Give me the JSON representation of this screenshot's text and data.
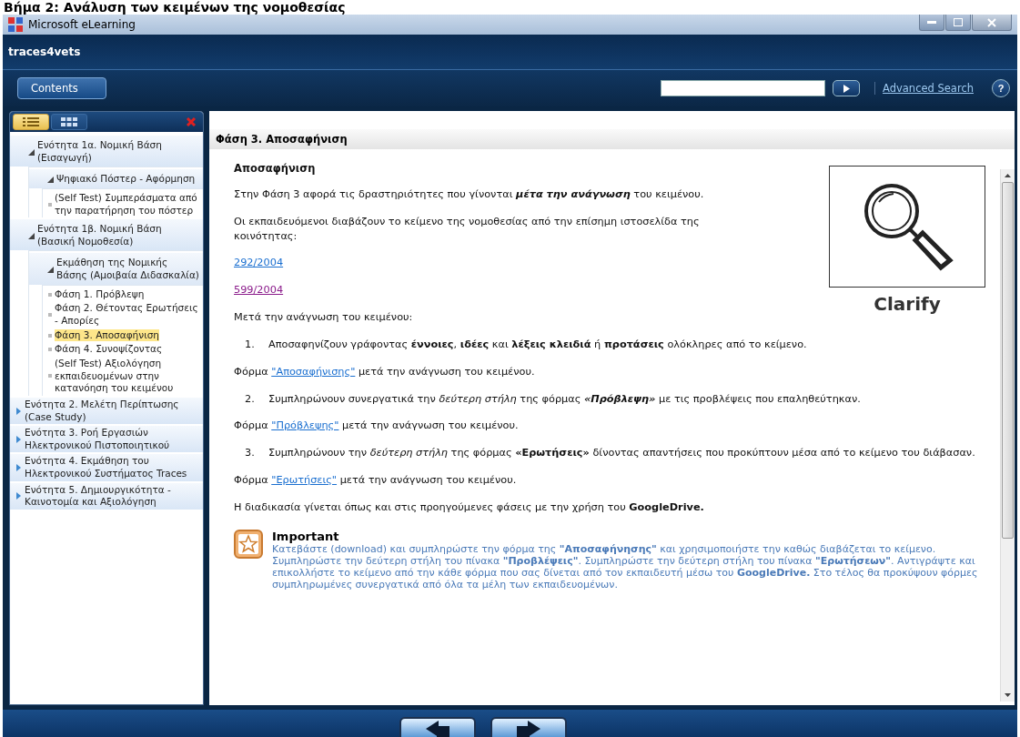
{
  "caption": "Βήμα 2: Ανάλυση των κειμένων της νομοθεσίας",
  "window": {
    "title": "Microsoft eLearning"
  },
  "app": {
    "title": "traces4vets"
  },
  "toolbar": {
    "contents_button": "Contents",
    "advanced_search": "Advanced Search",
    "help": "?"
  },
  "sidebar": {
    "views": [
      {
        "kind": "list",
        "selected": true
      },
      {
        "kind": "grid",
        "selected": false
      }
    ],
    "tree": [
      {
        "label": "Ενότητα 1α. Νομική Βάση (Εισαγωγή)",
        "expanded": true,
        "selected": false,
        "children": [
          {
            "label": "Ψηφιακό Πόστερ - Αφόρμηση",
            "expanded": true,
            "selected": false,
            "children": [
              {
                "label": "(Self Test) Συμπεράσματα από την παρατήρηση του πόστερ",
                "selected": false
              }
            ]
          }
        ]
      },
      {
        "label": "Ενότητα 1β. Νομική Βάση (Βασική Νομοθεσία)",
        "expanded": true,
        "selected": false,
        "children": [
          {
            "label": "Εκμάθηση της Νομικής Βάσης (Αμοιβαία Διδασκαλία)",
            "expanded": true,
            "selected": false,
            "children": [
              {
                "label": "Φάση 1. Πρόβλεψη",
                "selected": false
              },
              {
                "label": "Φάση 2. Θέτοντας Ερωτήσεις - Απορίες",
                "selected": false
              },
              {
                "label": "Φάση 3. Αποσαφήνιση",
                "selected": true
              },
              {
                "label": "Φάση 4. Συνοψίζοντας",
                "selected": false
              },
              {
                "label": "(Self Test) Αξιολόγηση εκπαιδευομένων στην κατανόηση του κειμένου",
                "selected": false
              }
            ]
          }
        ]
      },
      {
        "label": "Ενότητα 2. Μελέτη Περίπτωσης (Case Study)",
        "expanded": false,
        "selected": false
      },
      {
        "label": "Ενότητα 3. Ροή Εργασιών Ηλεκτρονικού Πιστοποιητικού",
        "expanded": false,
        "selected": false
      },
      {
        "label": "Ενότητα 4. Εκμάθηση του Ηλεκτρονικού Συστήματος Traces",
        "expanded": false,
        "selected": false
      },
      {
        "label": "Ενότητα 5. Δημιουργικότητα - Καινοτομία και Αξιολόγηση",
        "expanded": false,
        "selected": false
      }
    ]
  },
  "content": {
    "title": "Φάση 3. Αποσαφήνιση",
    "figure": {
      "label": "Clarify"
    },
    "blocks": [
      {
        "kind": "heading",
        "text": "Αποσαφήνιση"
      },
      {
        "kind": "para",
        "runs": [
          {
            "text": "Στην Φάση 3 αφορά τις δραστηριότητες που γίνονται ",
            "bold": false,
            "italic": false
          },
          {
            "text": "μέτα την ανάγνωση",
            "bold": true,
            "italic": true
          },
          {
            "text": " του κειμένου.",
            "bold": false,
            "italic": false
          }
        ]
      },
      {
        "kind": "para",
        "text": "Οι εκπαιδευόμενοι διαβάζουν το κείμενο της νομοθεσίας από την επίσημη ιστοσελίδα της κοινότητας:"
      },
      {
        "kind": "link",
        "text": "292/2004",
        "visited": false
      },
      {
        "kind": "link",
        "text": "599/2004",
        "visited": true
      },
      {
        "kind": "para",
        "text": "Μετά την ανάγνωση του κειμένου:"
      },
      {
        "kind": "item",
        "number": "1.",
        "text": "Αποσαφηνίζουν γράφοντας **έννοιες**, **ιδέες** και **λέξεις κλειδιά** ή **προτάσεις** ολόκληρες από το κείμενο."
      },
      {
        "kind": "form",
        "before": "Φόρμα",
        "link": "\"Αποσαφήνισης\"",
        "after": "μετά την ανάγνωση του κειμένου."
      },
      {
        "kind": "item",
        "number": "2.",
        "runs": [
          {
            "text": "Συμπληρώνουν συνεργατικά την ",
            "bold": false,
            "italic": false
          },
          {
            "text": "δεύτερη στήλη",
            "bold": false,
            "italic": true
          },
          {
            "text": " της φόρμας ",
            "bold": false,
            "italic": false
          },
          {
            "text": "«Πρόβλεψη»",
            "bold": true,
            "italic": true
          },
          {
            "text": " με τις προβλέψεις που επαληθεύτηκαν.",
            "bold": false,
            "italic": false
          }
        ]
      },
      {
        "kind": "form",
        "before": "Φόρμα",
        "link": "\"Πρόβλεψης\"",
        "after": "μετά την ανάγνωση του κειμένου."
      },
      {
        "kind": "item",
        "number": "3.",
        "text": "Συμπληρώνουν την *δεύτερη στήλη* της φόρμας **«Ερωτήσεις»** δίνοντας απαντήσεις που προκύπτουν μέσα από το κείμενο του διάβασαν."
      },
      {
        "kind": "form",
        "before": "Φόρμα",
        "link": "\"Ερωτήσεις\"",
        "after": "μετά την ανάγνωση του κειμένου."
      },
      {
        "kind": "para",
        "text": "Η διαδικασία γίνεται όπως και στις προηγούμενες φάσεις με την χρήση του **GoogleDrive.**"
      }
    ],
    "important": {
      "title": "Important",
      "text": "Κατεβάστε (download) και συμπληρώστε την φόρμα της  **\"Αποσαφήνησης\"** και χρησιμοποιήστε την καθώς διαβάζεται το κείμενο. Συμπληρώστε την δεύτερη στήλη του πίνακα **\"Προβλέψεις\"**. Συμπληρώστε την δεύτερη στήλη του πίνακα **\"Ερωτήσεων\"**. Αντιγράψτε και επικολλήστε το κείμενο από την κάθε φόρμα που σας δίνεται από τον εκπαιδευτή μέσω του **GoogleDrive.** Στο τέλος θα προκύψουν φόρμες συμπληρωμένες συνεργατικά από όλα τα μέλη των εκπαιδευομένων."
    }
  }
}
